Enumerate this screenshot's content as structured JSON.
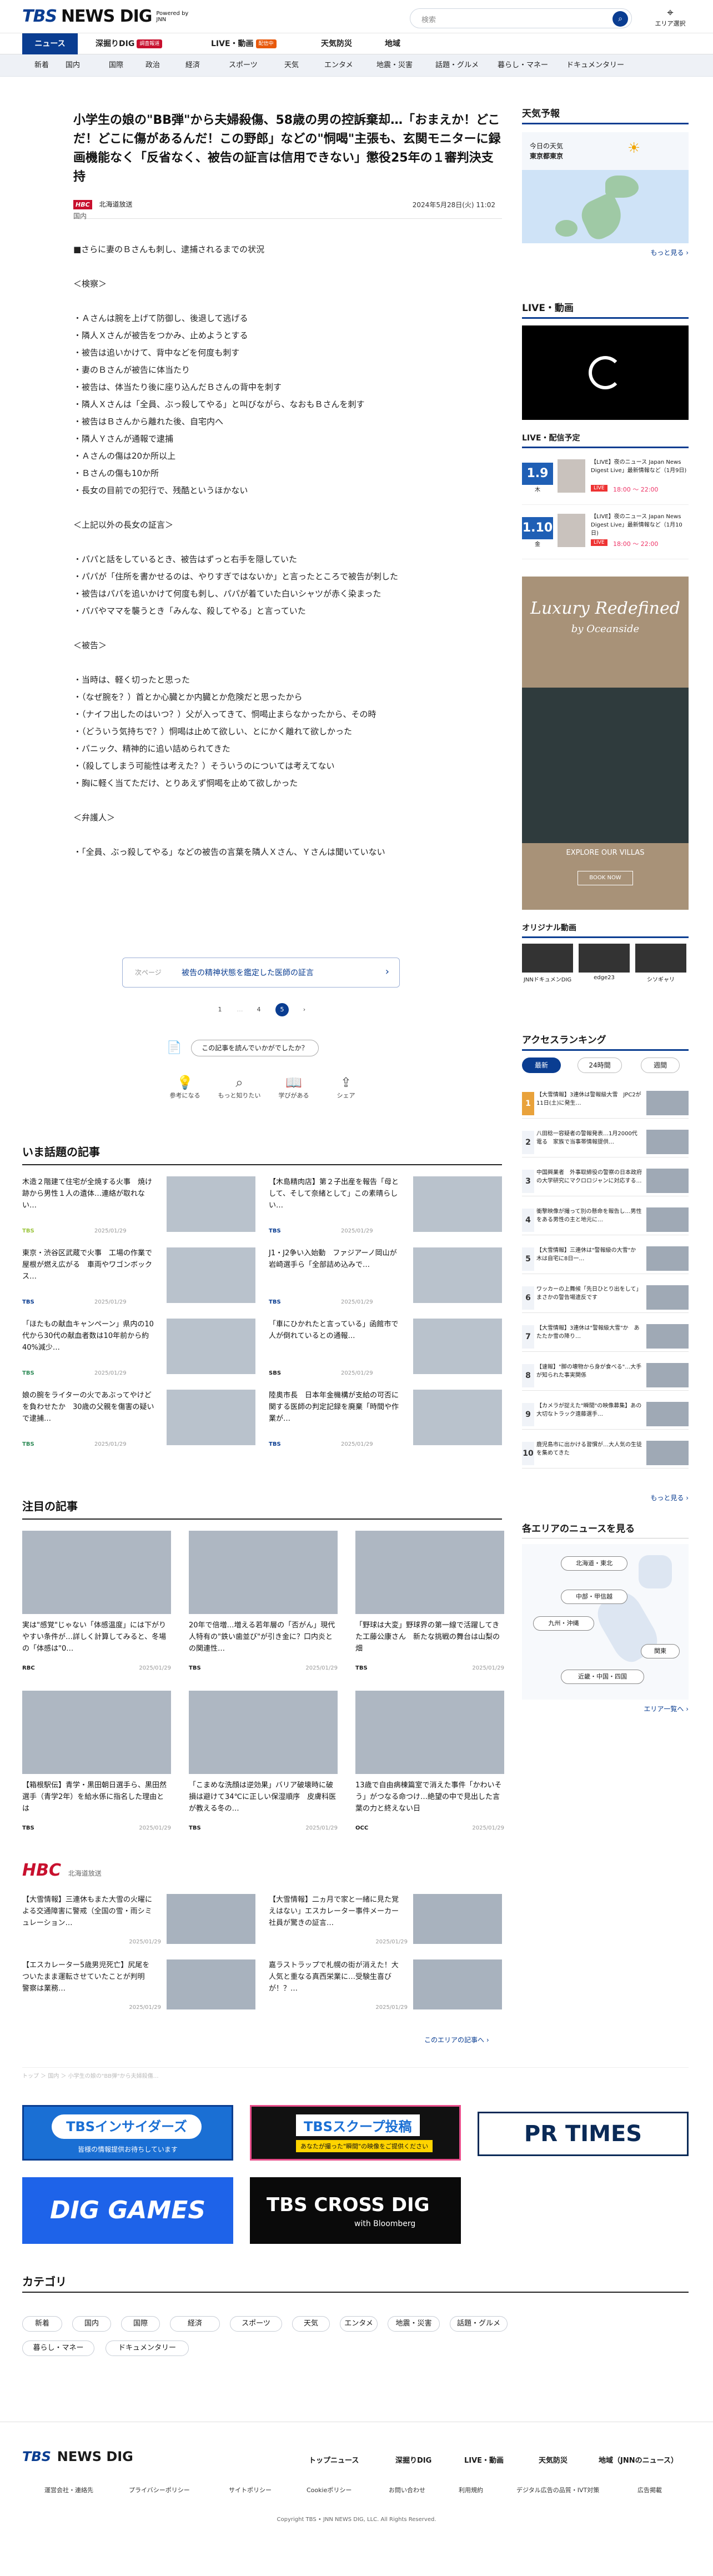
{
  "header": {
    "logo_main": "TBS",
    "logo_sub": "NEWS DIG",
    "powered": "Powered by JNN",
    "search_placeholder": "検索",
    "area_label": "エリア選択"
  },
  "nav": [
    {
      "label": "ニュース"
    },
    {
      "label": "深掘りDIG",
      "tag": "調査報道"
    },
    {
      "label": "LIVE・動画",
      "tag": "配信中"
    },
    {
      "label": "天気防災"
    },
    {
      "label": "地域"
    }
  ],
  "subnav": [
    "新着",
    "国内",
    "国際",
    "政治",
    "経済",
    "スポーツ",
    "天気",
    "エンタメ",
    "地震・災害",
    "話題・グルメ",
    "暮らし・マネー",
    "ドキュメンタリー"
  ],
  "article": {
    "title": "小学生の娘の\"BB弾\"から夫婦殺傷、58歳の男の控訴棄却…「おまえか！どこだ！どこに傷があるんだ！この野郎」などの\"恫喝\"主張も、玄関モニターに録画機能なく「反省なく、被告の証言は信用できない」懲役25年の１審判決支持",
    "station_logo": "HBC",
    "station": "北海道放送",
    "date": "2024年5月28日(火) 11:02",
    "category": "国内",
    "paragraphs": [
      "■さらに妻のＢさんも刺し、逮捕されるまでの状況",
      "",
      "＜検察＞",
      "",
      "・Ａさんは腕を上げて防御し、後退して逃げる",
      "・隣人Ｘさんが被告をつかみ、止めようとする",
      "・被告は追いかけて、背中などを何度も刺す",
      "・妻のＢさんが被告に体当たり",
      "・被告は、体当たり後に座り込んだＢさんの背中を刺す",
      "・隣人Ｘさんは「全員、ぶっ殺してやる」と叫びながら、なおもＢさんを刺す",
      "・被告はＢさんから離れた後、自宅内へ",
      "・隣人Ｙさんが通報で逮捕",
      "・Ａさんの傷は20か所以上",
      "・Ｂさんの傷も10か所",
      "・長女の目前での犯行で、残酷というほかない",
      "",
      "＜上記以外の長女の証言＞",
      "",
      "・パパと話をしているとき、被告はずっと右手を隠していた",
      "・パパが「住所を書かせるのは、やりすぎではないか」と言ったところで被告が刺した",
      "・被告はパパを追いかけて何度も刺し、パパが着ていた白いシャツが赤く染まった",
      "・パパやママを襲うとき「みんな、殺してやる」と言っていた",
      "",
      "＜被告＞",
      "",
      "・当時は、軽く切ったと思った",
      "・（なぜ腕を？）首とか心臓とか内臓とか危険だと思ったから",
      "・（ナイフ出したのはいつ？）父が入ってきて、恫喝止まらなかったから、その時",
      "・（どういう気持ちで？）恫喝は止めて欲しい、とにかく離れて欲しかった",
      "・パニック、精神的に追い詰められてきた",
      "・（殺してしまう可能性は考えた？）そういうのについては考えてない",
      "・胸に軽く当てただけ、とりあえず恫喝を止めて欲しかった",
      "",
      "＜弁護人＞",
      "",
      "・「全員、ぶっ殺してやる」などの被告の言葉を隣人Ｘさん、Ｙさんは聞いていない"
    ],
    "next_label": "次ページ",
    "next_title": "被告の精神状態を鑑定した医師の証言",
    "pages": [
      "1",
      "2",
      "3",
      "4",
      "5"
    ],
    "current_page": "5",
    "survey": "この記事を読んでいかがでしたか？",
    "reactions": [
      "参考になる",
      "もっと知りたい",
      "学びがある",
      "シェア"
    ]
  },
  "hot_topics": {
    "title": "いま話題の記事",
    "items": [
      {
        "text": "木造２階建て住宅が全焼する火事　焼け跡から男性１人の遺体…連絡が取れない…",
        "brand": "TBS",
        "brand_color": "#9bc53d",
        "date": "2025/01/29"
      },
      {
        "text": "【木島精肉店】第２子出産を報告「母として、そして奈緒として」この素晴らしい…",
        "brand": "TBS",
        "brand_color": "#0a3d91",
        "date": "2025/01/29"
      },
      {
        "text": "東京・渋谷区武蔵で火事　工場の作業で屋根が燃え広がる　車両やワゴンボックス…",
        "brand": "TBS",
        "brand_color": "#0a3d91",
        "date": "2025/01/29"
      },
      {
        "text": "J1・J2争い入始動　ファジアーノ岡山が岩崎選手ら「全部詰め込みで…",
        "brand": "TBS",
        "brand_color": "#0a3d91",
        "date": "2025/01/29"
      },
      {
        "text": "「ほたもの献血キャンペーン」県内の10代から30代の献血者数は10年前から約40%減少…",
        "brand": "TBS",
        "brand_color": "#2e8b57",
        "date": "2025/01/29"
      },
      {
        "text": "「車にひかれたと言っている」函館市で人が倒れているとの通報…",
        "brand": "SBS",
        "brand_color": "#222",
        "date": "2025/01/29"
      },
      {
        "text": "娘の腕をライターの火であぶってやけどを負わせたか　30歳の父親を傷害の疑いで逮捕…",
        "brand": "TBS",
        "brand_color": "#2e8b57",
        "date": "2025/01/29"
      },
      {
        "text": "陸奥市長　日本年金機構が支給の可否に関する医師の判定記録を廃棄「時間や作業が…",
        "brand": "TBS",
        "brand_color": "#0a3d91",
        "date": "2025/01/29"
      }
    ]
  },
  "featured": {
    "title": "注目の記事",
    "items": [
      {
        "text": "実は\"感覚\"じゃない「体感温度」には下がりやすい条件が…詳しく計算してみると、冬場の「体感は\"0…",
        "brand": "RBC",
        "date": "2025/01/29"
      },
      {
        "text": "20年で倍増…増える若年層の「否がん」現代人特有の\"鉄い歯並び\"が引き金に？口内炎との関連性…",
        "brand": "TBS",
        "date": "2025/01/29"
      },
      {
        "text": "「野球は大変」野球界の第一線で活躍してきた工藤公康さん　新たな挑戦の舞台は山梨の畑",
        "brand": "TBS",
        "date": "2025/01/29"
      },
      {
        "text": "【箱根駅伝】青学・黒田朝日選手ら、黒田然選手（青学2年）を給水係に指名した理由とは",
        "brand": "TBS",
        "date": "2025/01/29"
      },
      {
        "text": "「こまめな洗顔は逆効果」バリア破壊時に破損は避けて34℃に正しい保湿順序　皮膚科医が教える冬の…",
        "brand": "TBS",
        "date": "2025/01/29"
      },
      {
        "text": "13歳で自由病棟篇室で消えた事件「かわいそう」がつなる命つけ…絶望の中で見出した言葉の力と終えない日",
        "brand": "OCC",
        "date": "2025/01/29"
      }
    ]
  },
  "hbc_section": {
    "logo": "HBC",
    "sub": "北海道放送",
    "items": [
      {
        "text": "【大雪情報】三連休もまた大雪の火曜による交通障害に警戒（全国の雪・雨シミュレーション…",
        "date": "2025/01/29"
      },
      {
        "text": "【大雪情報】二ヵ月で家と一緒に見た覚えはない」エスカレーター事件メーカー社員が驚きの証言…",
        "date": "2025/01/29"
      },
      {
        "text": "【エスカレーター5歳男児死亡】尻尾をついたまま運転させていたことが判明　警察は業務…",
        "date": "2025/01/29"
      },
      {
        "text": "嘉ラストラップで札幌の街が消えた！大人気と重なる真西栄業に…受験生喜びが！？…",
        "date": "2025/01/29"
      }
    ],
    "more": "このエリアの記事へ ›"
  },
  "breadcrumb": "トップ ＞ 国内 ＞ 小学生の娘の\"BB弾\"から夫婦殺傷…",
  "banners": [
    {
      "title": "TBSインサイダーズ",
      "sub": "皆様の情報提供お待ちしています"
    },
    {
      "title": "TBSスクープ投稿",
      "sub": "あなたが撮った\"瞬間\"の映像をご提供ください"
    },
    {
      "title": "PR TIMES",
      "sub": ""
    },
    {
      "title": "DIG GAMES",
      "sub": ""
    },
    {
      "title": "TBS CROSS DIG",
      "sub": "with Bloomberg"
    }
  ],
  "categories": {
    "title": "カテゴリ",
    "items": [
      "新着",
      "国内",
      "国際",
      "経済",
      "スポーツ",
      "天気",
      "エンタメ",
      "地震・災害",
      "話題・グルメ",
      "暮らし・マネー",
      "ドキュメンタリー"
    ]
  },
  "sidebar": {
    "weather_title": "天気予報",
    "weather_today": "今日の天気",
    "weather_area": "東京都東京",
    "weather_more": "もっと見る ›",
    "live_title": "LIVE・動画",
    "schedule_title": "LIVE・配信予定",
    "schedule": [
      {
        "date": "1.9",
        "day": "木",
        "badge": "LIVE",
        "title": "【LIVE】夜のニュース Japan News Digest Live」最新情報など（1月9日)",
        "time": "18:00 〜 22:00"
      },
      {
        "date": "1.10",
        "day": "金",
        "badge": "LIVE",
        "title": "【LIVE】夜のニュース Japan News Digest Live」最新情報など（1月10日)",
        "time": "18:00 〜 22:00"
      }
    ],
    "ad_title": "Luxury Redefined",
    "ad_sub": "by Oceanside",
    "ad_cta": "EXPLORE OUR VILLAS",
    "ad_btn": "BOOK NOW",
    "original_title": "オリジナル動画",
    "originals": [
      "JNNドキュメンDIG",
      "edge23",
      "シソギャリ"
    ],
    "ranking_title": "アクセスランキング",
    "ranking_tabs": [
      "最新",
      "24時間",
      "週間"
    ],
    "ranking": [
      {
        "n": "1",
        "text": "【大雪情報】3連休は警報級大雪　JPC2が11日(土)に発生…"
      },
      {
        "n": "2",
        "text": "八田稔一容疑者の警報発表…1月2000代電る　家族で当事帯情報提供…"
      },
      {
        "n": "3",
        "text": "中国興業者　外事取締役の警察の日本政府の大学研究にマクロロジャンに対応する…"
      },
      {
        "n": "4",
        "text": "衝撃映像が撮って別の懸命を報告し…男性をある男性の主と地元に…"
      },
      {
        "n": "5",
        "text": "【大雪情報】三連休は\"警報級の大雪\"か　木は自宅に8日一…"
      },
      {
        "n": "6",
        "text": "ワッカーの上舞候「先日ひとり出をして」まさかの警告場違反です"
      },
      {
        "n": "7",
        "text": "【大雪情報】3連休は\"警報級大雪\"か　あたたか雪の降り…"
      },
      {
        "n": "8",
        "text": "【速報】\"脚の壊物から身が食べる\"…大手が知られた事実関係"
      },
      {
        "n": "9",
        "text": "【カメラが捉えた\"瞬間\"の映像募集】あの大切なトラック遠藤選手…"
      },
      {
        "n": "10",
        "text": "鹿児島市に出かける習慣が…大人気の生徒を集めてきた"
      }
    ],
    "ranking_more": "もっと見る ›",
    "area_title": "各エリアのニュースを見る",
    "areas": [
      "北海道・東北",
      "中部・甲信越",
      "九州・沖縄",
      "関東",
      "近畿・中国・四国"
    ],
    "area_more": "エリア一覧へ ›"
  },
  "footer": {
    "links": [
      "トップニュース",
      "深掘りDIG",
      "LIVE・動画",
      "天気防災",
      "地域（JNNのニュース）"
    ],
    "small": [
      "運営会社・連絡先",
      "プライバシーポリシー",
      "サイトポリシー",
      "Cookieポリシー",
      "お問い合わせ",
      "利用規約",
      "デジタル広告の品質・IVT対策",
      "広告掲載"
    ],
    "copyright": "Copyright TBS • JNN NEWS DIG, LLC. All Rights Reserved."
  }
}
